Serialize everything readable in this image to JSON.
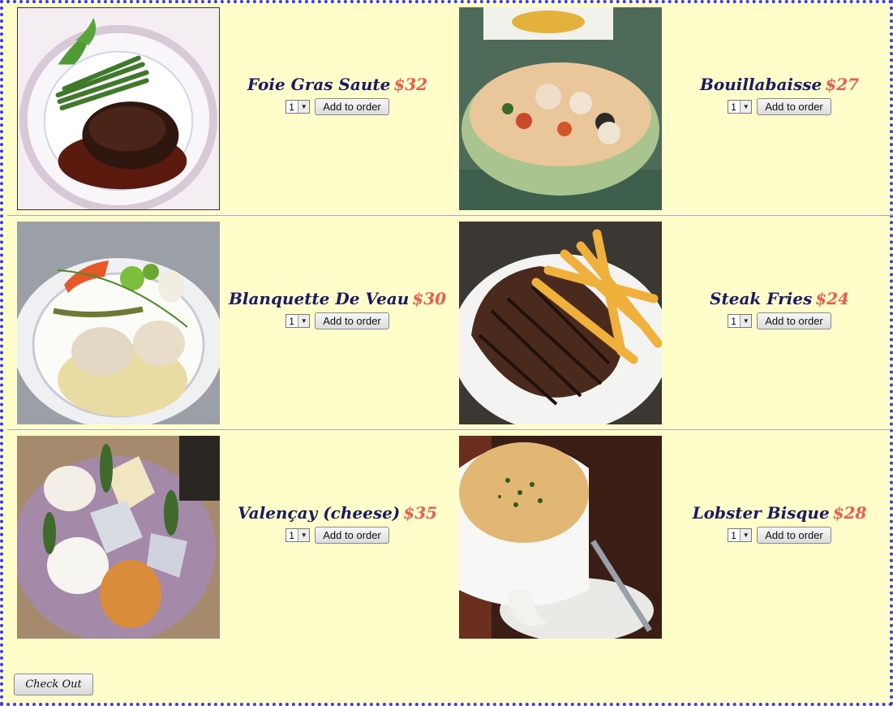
{
  "menu": {
    "currency_symbol": "$",
    "colors": {
      "title": "#1a1a66",
      "price": "#f05a4a",
      "background": "#fffdc9",
      "frame": "#3a3af0"
    },
    "items": [
      {
        "name": "Foie Gras Saute",
        "price": "$32",
        "qty": "1",
        "button": "Add to order",
        "photo_icon": "foie-gras-plate-photo"
      },
      {
        "name": "Bouillabaisse",
        "price": "$27",
        "qty": "1",
        "button": "Add to order",
        "photo_icon": "bouillabaisse-bowl-photo"
      },
      {
        "name": "Blanquette De Veau",
        "price": "$30",
        "qty": "1",
        "button": "Add to order",
        "photo_icon": "blanquette-plate-photo"
      },
      {
        "name": "Steak Fries",
        "price": "$24",
        "qty": "1",
        "button": "Add to order",
        "photo_icon": "steak-fries-plate-photo"
      },
      {
        "name": "Valençay (cheese)",
        "price": "$35",
        "qty": "1",
        "button": "Add to order",
        "photo_icon": "cheese-board-photo"
      },
      {
        "name": "Lobster Bisque",
        "price": "$28",
        "qty": "1",
        "button": "Add to order",
        "photo_icon": "lobster-bisque-cup-photo"
      }
    ]
  },
  "checkout": {
    "label": "Check Out"
  }
}
